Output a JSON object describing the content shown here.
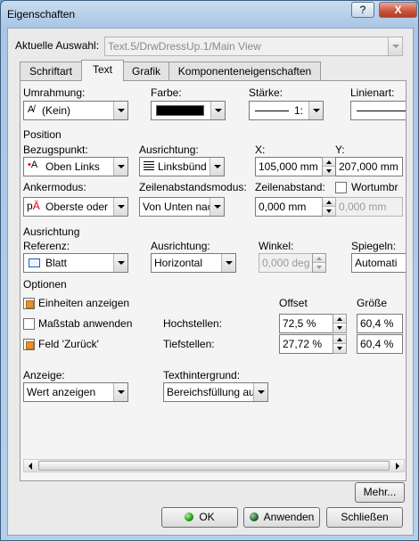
{
  "window": {
    "title": "Eigenschaften",
    "help_label": "?",
    "close_label": "X"
  },
  "selection": {
    "label": "Aktuelle Auswahl:",
    "value": "Text.5/DrwDressUp.1/Main View"
  },
  "tabs": [
    {
      "label": "Schriftart"
    },
    {
      "label": "Text"
    },
    {
      "label": "Grafik"
    },
    {
      "label": "Komponenteneigenschaften"
    }
  ],
  "frame": {
    "umrahmung_label": "Umrahmung:",
    "umrahmung_value": "(Kein)",
    "farbe_label": "Farbe:",
    "farbe_color": "#000000",
    "staerke_label": "Stärke:",
    "staerke_value": "1:",
    "linienart_label": "Linienart:"
  },
  "position": {
    "section_label": "Position",
    "bezugspunkt_label": "Bezugspunkt:",
    "bezugspunkt_value": "Oben Links",
    "ausrichtung_label": "Ausrichtung:",
    "ausrichtung_value": "Linksbünd",
    "x_label": "X:",
    "x_value": "105,000 mm",
    "y_label": "Y:",
    "y_value": "207,000 mm",
    "ankermodus_label": "Ankermodus:",
    "ankermodus_value": "Oberste oder",
    "zeilenabstandsmodus_label": "Zeilenabstandsmodus:",
    "zeilenabstandsmodus_value": "Von Unten nac",
    "zeilenabstand_label": "Zeilenabstand:",
    "zeilenabstand_value": "0,000 mm",
    "wortumbruch_label": "Wortumbr",
    "wortumbruch_checked": false,
    "wortumbruch_value": "0,000 mm"
  },
  "alignment": {
    "section_label": "Ausrichtung",
    "referenz_label": "Referenz:",
    "referenz_value": "Blatt",
    "ausrichtung_label": "Ausrichtung:",
    "ausrichtung_value": "Horizontal",
    "winkel_label": "Winkel:",
    "winkel_value": "0,000 deg",
    "spiegeln_label": "Spiegeln:",
    "spiegeln_value": "Automati"
  },
  "options": {
    "section_label": "Optionen",
    "offset_header": "Offset",
    "groesse_header": "Größe",
    "einheiten_label": "Einheiten anzeigen",
    "einheiten_checked": true,
    "massstab_label": "Maßstab anwenden",
    "massstab_checked": false,
    "feld_label": "Feld 'Zurück'",
    "feld_checked": true,
    "hochstellen_label": "Hochstellen:",
    "hochstellen_offset": "72,5 %",
    "hochstellen_groesse": "60,4 %",
    "tiefstellen_label": "Tiefstellen:",
    "tiefstellen_offset": "27,72 %",
    "tiefstellen_groesse": "60,4 %"
  },
  "display": {
    "anzeige_label": "Anzeige:",
    "anzeige_value": "Wert anzeigen",
    "texthintergrund_label": "Texthintergrund:",
    "texthintergrund_value": "Bereichsfüllung au"
  },
  "buttons": {
    "mehr": "Mehr...",
    "ok": "OK",
    "anwenden": "Anwenden",
    "schliessen": "Schließen"
  }
}
